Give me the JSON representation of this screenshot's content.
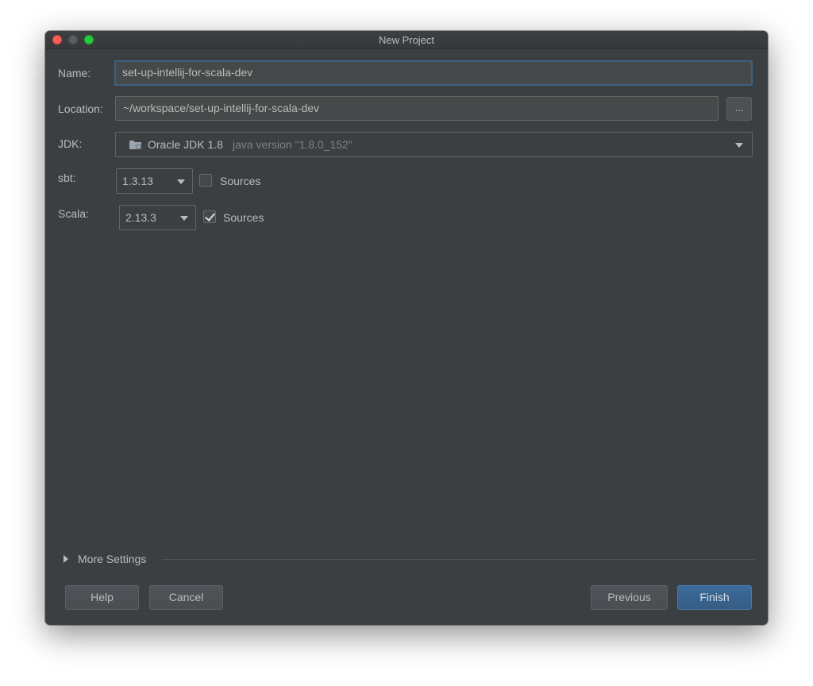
{
  "window": {
    "title": "New Project"
  },
  "form": {
    "name": {
      "label": "Name:",
      "value": "set-up-intellij-for-scala-dev"
    },
    "location": {
      "label": "Location:",
      "value": "~/workspace/set-up-intellij-for-scala-dev",
      "browse_label": "..."
    },
    "jdk": {
      "label": "JDK:",
      "name": "Oracle JDK 1.8",
      "version": "java version \"1.8.0_152\"",
      "icon": "jdk-folder-icon"
    },
    "sbt": {
      "label": "sbt:",
      "version": "1.3.13",
      "sources_label": "Sources",
      "sources_checked": false
    },
    "scala": {
      "label": "Scala:",
      "version": "2.13.3",
      "sources_label": "Sources",
      "sources_checked": true
    }
  },
  "more_settings": {
    "label": "More Settings"
  },
  "buttons": {
    "help": "Help",
    "cancel": "Cancel",
    "previous": "Previous",
    "finish": "Finish"
  },
  "colors": {
    "background": "#3c3f41",
    "accent": "#365d85",
    "text": "#bbbbbb"
  }
}
